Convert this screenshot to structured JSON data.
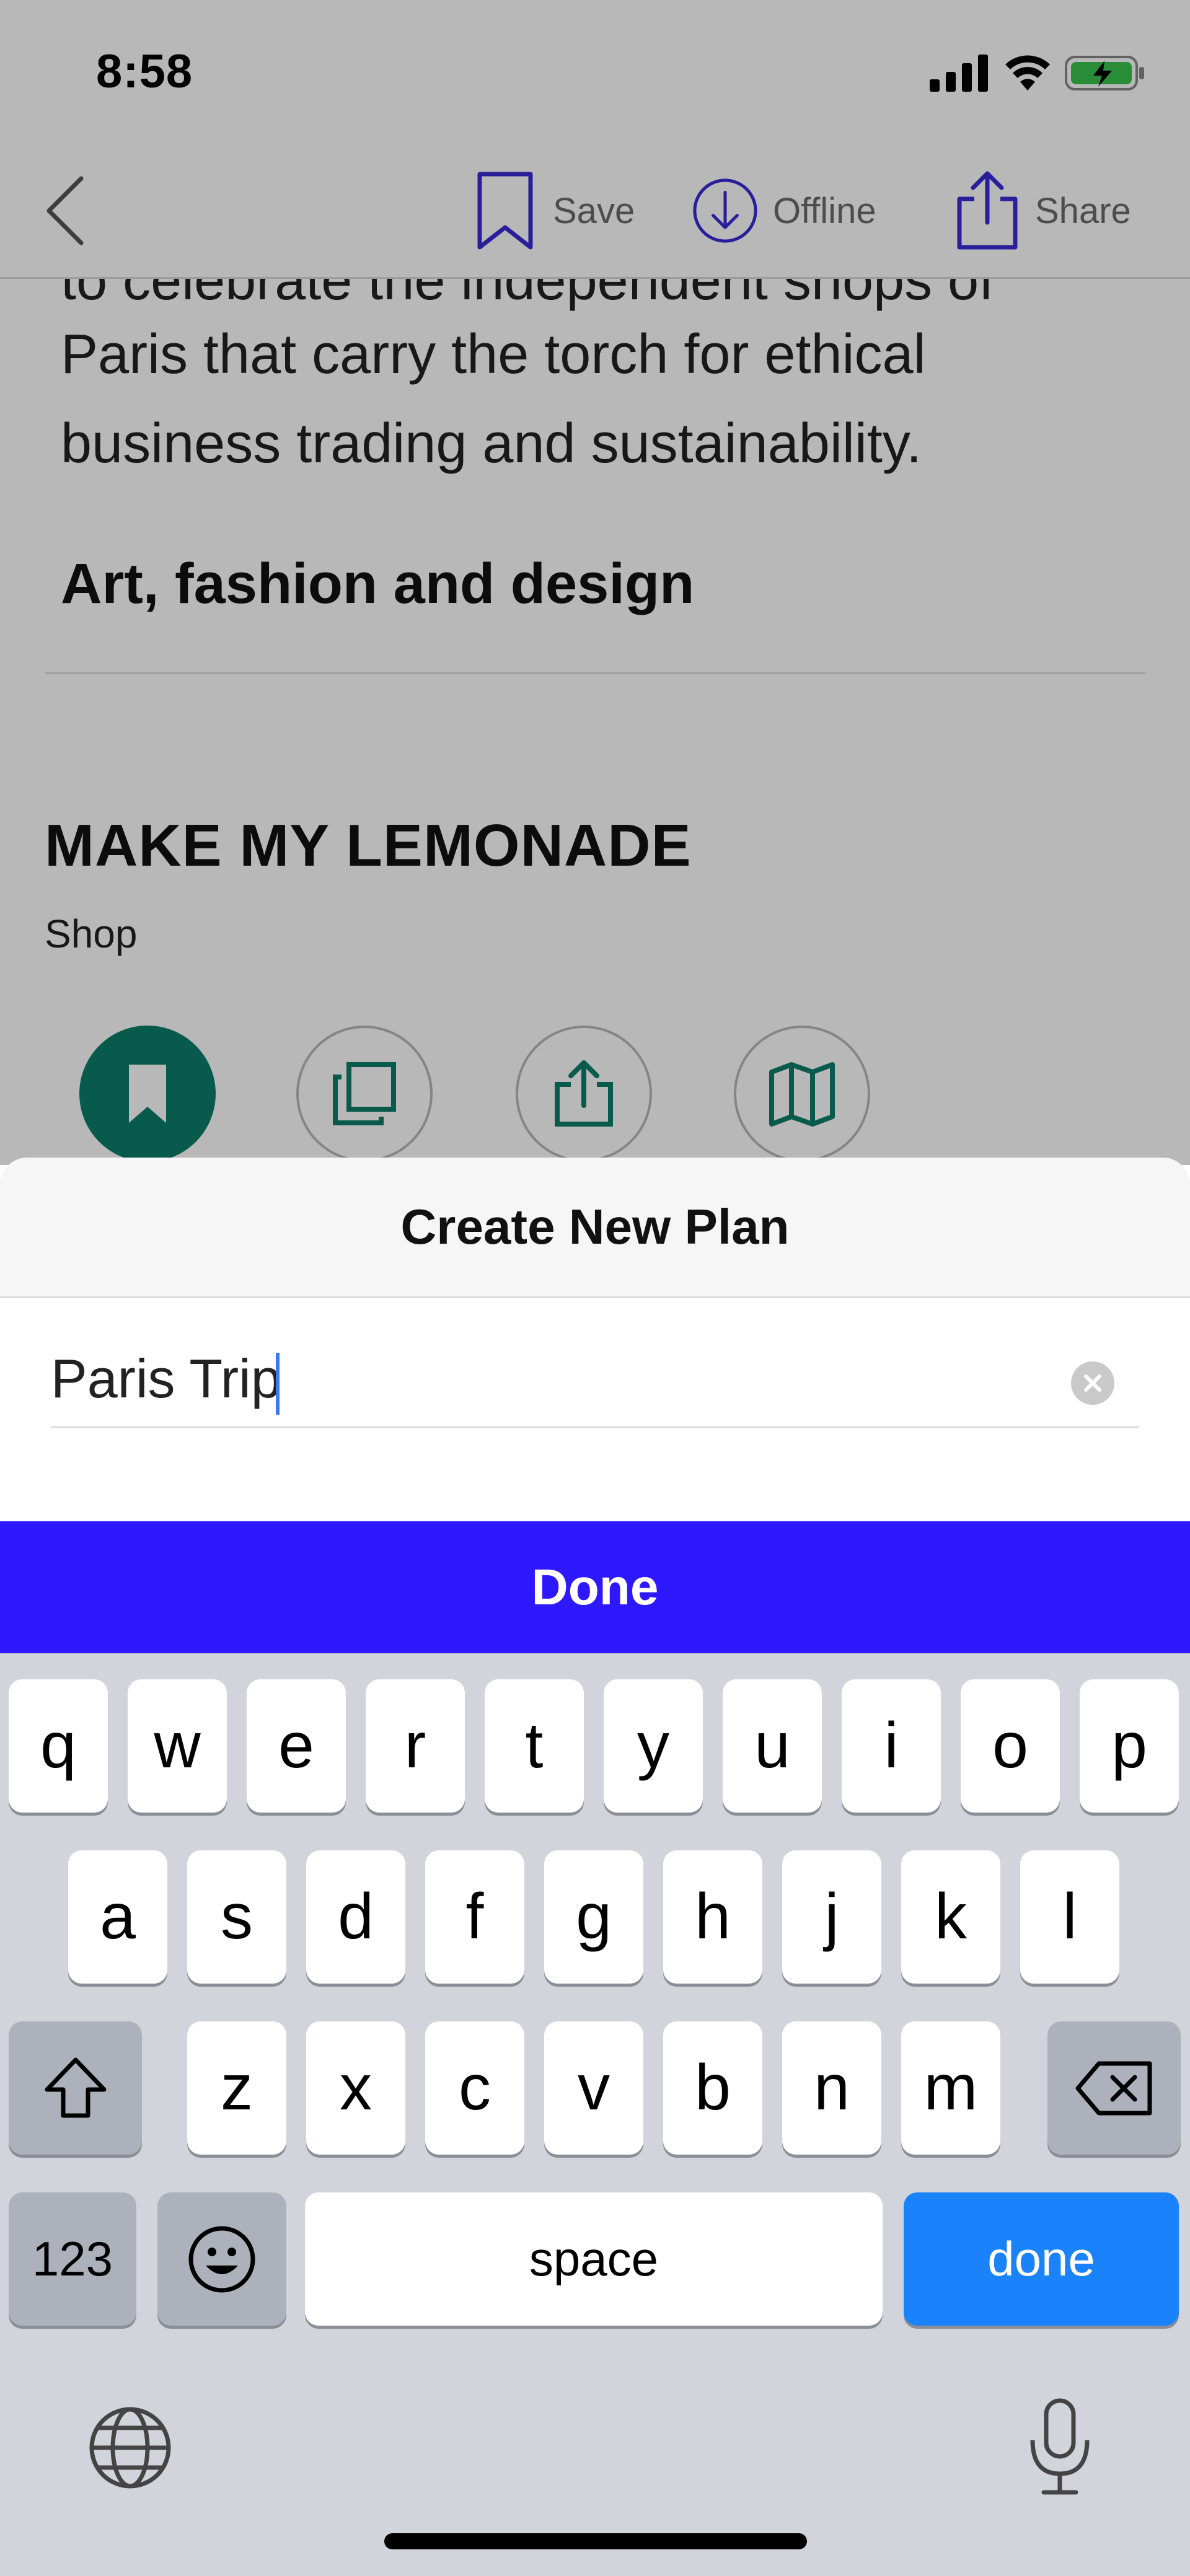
{
  "status_bar": {
    "time": "8:58",
    "battery_color": "#3ac24b"
  },
  "nav": {
    "back_icon": "chevron-left-icon",
    "save_label": "Save",
    "offline_label": "Offline",
    "share_label": "Share",
    "accent": "#3a2bd6"
  },
  "article": {
    "clipped_line": "to celebrate the independent shops of",
    "paragraph": "Paris that carry the torch for ethical business trading and sustainability.",
    "section_heading": "Art, fashion and design",
    "place_title": "MAKE MY LEMONADE",
    "place_type": "Shop",
    "action_icons": [
      "bookmark-icon",
      "copy-icon",
      "share-icon",
      "map-icon"
    ],
    "action_color": "#0a7d6a"
  },
  "sheet": {
    "title": "Create New Plan",
    "input_value": "Paris Trip",
    "done_label": "Done",
    "done_color": "#2e19ff"
  },
  "keyboard": {
    "row1": [
      "q",
      "w",
      "e",
      "r",
      "t",
      "y",
      "u",
      "i",
      "o",
      "p"
    ],
    "row2": [
      "a",
      "s",
      "d",
      "f",
      "g",
      "h",
      "j",
      "k",
      "l"
    ],
    "row3": [
      "z",
      "x",
      "c",
      "v",
      "b",
      "n",
      "m"
    ],
    "numbers_label": "123",
    "space_label": "space",
    "return_label": "done",
    "return_color": "#1a82fb"
  }
}
